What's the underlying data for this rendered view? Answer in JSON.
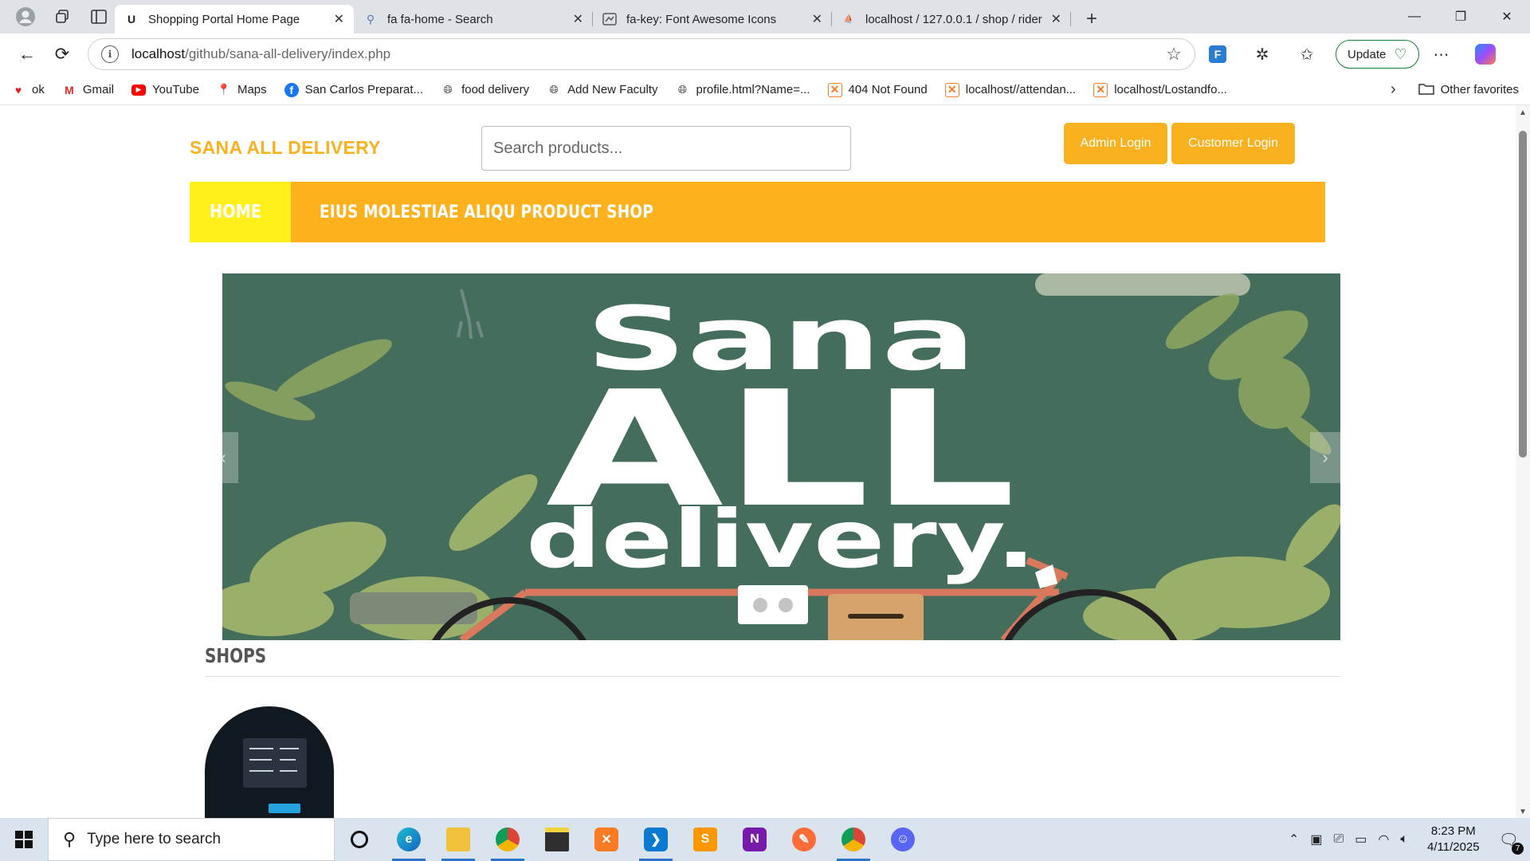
{
  "browser": {
    "tabs": [
      {
        "title": "Shopping Portal Home Page",
        "icon": "u-logo-icon",
        "active": true
      },
      {
        "title": "fa fa-home - Search",
        "icon": "search-icon",
        "active": false
      },
      {
        "title": "fa-key: Font Awesome Icons",
        "icon": "flag-icon",
        "active": false
      },
      {
        "title": "localhost / 127.0.0.1 / shop / rider",
        "icon": "phpmyadmin-icon",
        "active": false
      }
    ],
    "address": {
      "host": "localhost",
      "path": "/github/sana-all-delivery/index.php"
    },
    "update_label": "Update",
    "favorites": [
      {
        "label": "ok",
        "icon": "heart-icon"
      },
      {
        "label": "Gmail",
        "icon": "gmail-icon"
      },
      {
        "label": "YouTube",
        "icon": "youtube-icon"
      },
      {
        "label": "Maps",
        "icon": "maps-icon"
      },
      {
        "label": "San Carlos Preparat...",
        "icon": "facebook-icon"
      },
      {
        "label": "food delivery",
        "icon": "globe-icon"
      },
      {
        "label": "Add New Faculty",
        "icon": "globe-icon"
      },
      {
        "label": "profile.html?Name=...",
        "icon": "globe-icon"
      },
      {
        "label": "404 Not Found",
        "icon": "xampp-icon"
      },
      {
        "label": "localhost//attendan...",
        "icon": "xampp-icon"
      },
      {
        "label": "localhost/Lostandfo...",
        "icon": "xampp-icon"
      }
    ],
    "other_favorites": "Other favorites"
  },
  "site": {
    "brand": "SANA ALL DELIVERY",
    "search_placeholder": "Search products...",
    "admin_login": "Admin Login",
    "customer_login": "Customer Login",
    "nav": {
      "home": "HOME",
      "shop": "EIUS MOLESTIAE ALIQU PRODUCT SHOP"
    },
    "banner": {
      "line1": "Sana",
      "line2": "ALL",
      "line3": "delivery.",
      "prev_glyph": "‹",
      "next_glyph": "›",
      "slide_count": 2
    },
    "shops_heading": "SHOPS"
  },
  "taskbar": {
    "search_placeholder": "Type here to search",
    "time": "8:23 PM",
    "date": "4/11/2025",
    "notification_count": "7",
    "apps": [
      "edge-icon",
      "file-explorer-icon",
      "chrome-icon",
      "sticky-notes-icon",
      "xampp-icon",
      "vscode-icon",
      "sublime-icon",
      "onenote-icon",
      "postman-icon",
      "chrome-profile-icon",
      "discord-icon"
    ]
  },
  "colors": {
    "brand_orange": "#f9b11f",
    "nav_orange": "#fdb21d",
    "home_yellow": "#ffef1a",
    "banner_green": "#446d5c"
  }
}
